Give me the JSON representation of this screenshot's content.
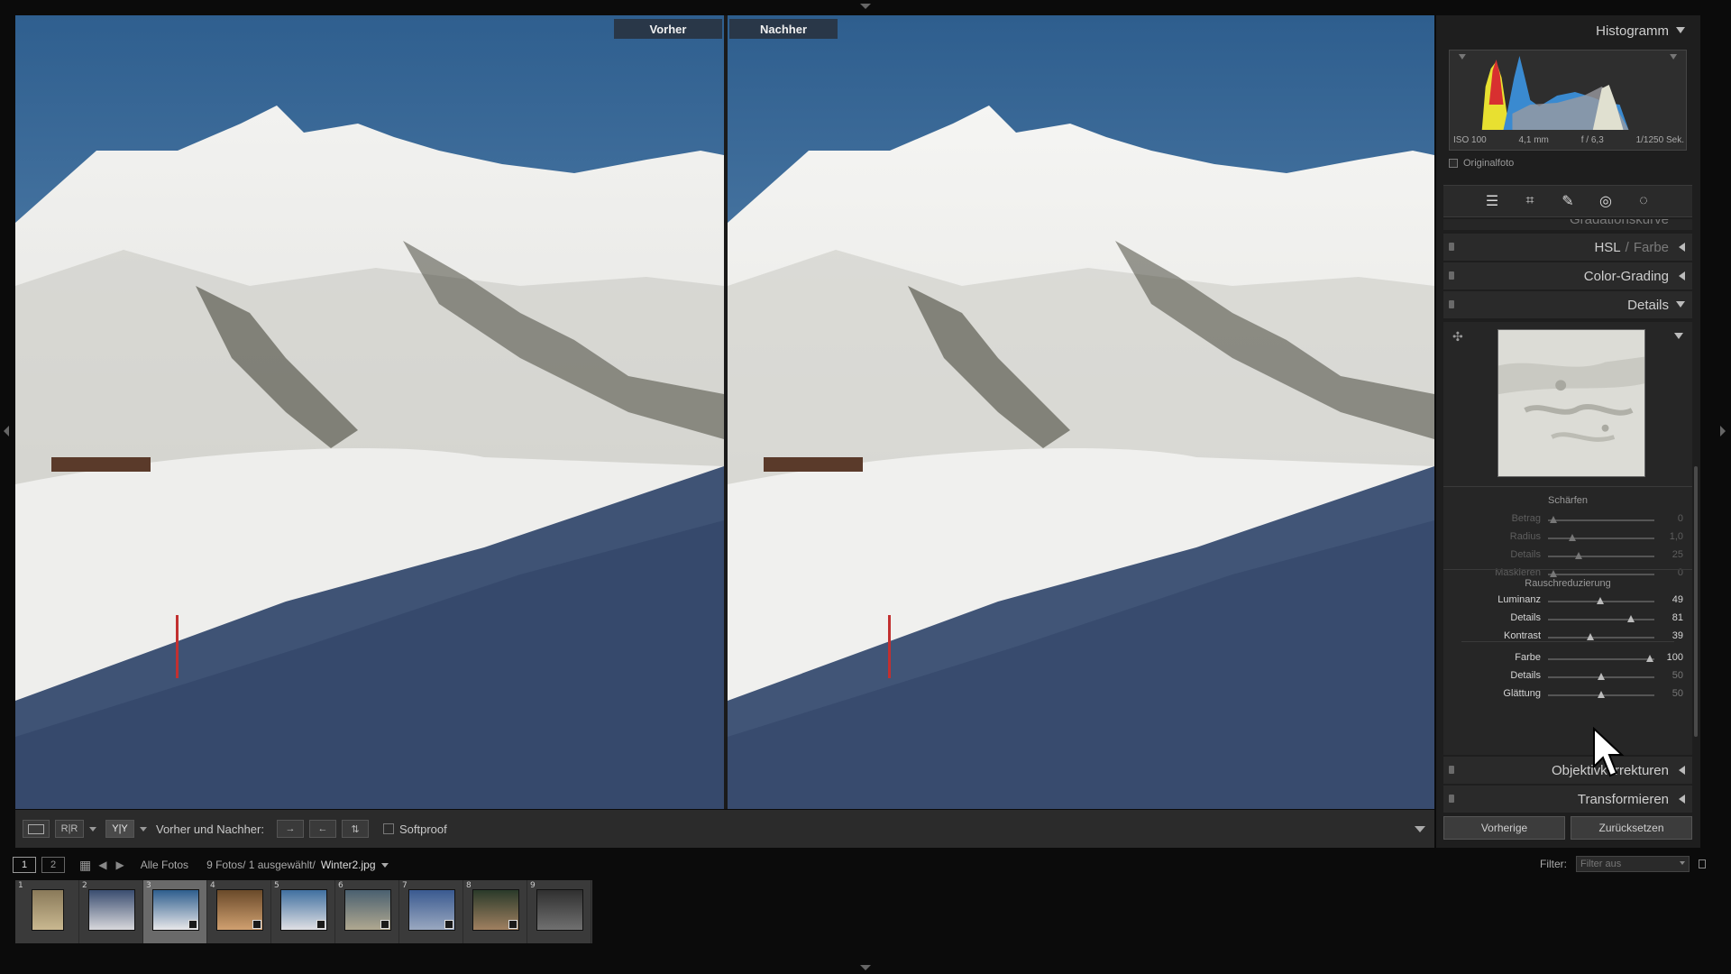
{
  "viewer": {
    "before_label": "Vorher",
    "after_label": "Nachher"
  },
  "toolbar": {
    "view_mode_label": "Vorher und Nachher:",
    "softproof_label": "Softproof",
    "btn_loupe": "",
    "btn_rr": "R|R",
    "btn_yy": "Y|Y"
  },
  "panels": {
    "histogram": "Histogramm",
    "histogram_info": {
      "iso": "ISO 100",
      "focal": "4,1 mm",
      "aperture": "f / 6,3",
      "shutter": "1/1250 Sek."
    },
    "original_photo": "Originalfoto",
    "gradation_curve": "Gradationskurve",
    "hsl": "HSL",
    "hsl_sep": "/",
    "color": "Farbe",
    "color_grading": "Color-Grading",
    "details": "Details",
    "lens_corrections": "Objektivkorrekturen",
    "transform": "Transformieren"
  },
  "details": {
    "sharpen_title": "Schärfen",
    "sharpen": [
      {
        "label": "Betrag",
        "value": "0",
        "pos": 0.05
      },
      {
        "label": "Radius",
        "value": "1,0",
        "pos": 0.23
      },
      {
        "label": "Details",
        "value": "25",
        "pos": 0.29
      },
      {
        "label": "Maskieren",
        "value": "0",
        "pos": 0.05
      }
    ],
    "noise_title": "Rauschreduzierung",
    "noise": [
      {
        "label": "Luminanz",
        "value": "49",
        "pos": 0.49
      },
      {
        "label": "Details",
        "value": "81",
        "pos": 0.78
      },
      {
        "label": "Kontrast",
        "value": "39",
        "pos": 0.4
      }
    ],
    "color_noise": [
      {
        "label": "Farbe",
        "value": "100",
        "pos": 0.96
      },
      {
        "label": "Details",
        "value": "50",
        "pos": 0.5
      },
      {
        "label": "Glättung",
        "value": "50",
        "pos": 0.5
      }
    ]
  },
  "buttons": {
    "previous": "Vorherige",
    "reset": "Zurücksetzen"
  },
  "filmstrip_bar": {
    "page1": "1",
    "page2": "2",
    "all_photos": "Alle Fotos",
    "count": "9 Fotos/ 1 ausgewählt/",
    "filename": "Winter2.jpg",
    "filter_label": "Filter:",
    "filter_value": "Filter aus"
  },
  "filmstrip": {
    "thumbs": [
      "1",
      "2",
      "3",
      "4",
      "5",
      "6",
      "7",
      "8",
      "9"
    ],
    "selected": 3
  },
  "colors": {
    "panel_bg": "#1e1e1e",
    "header_bg": "#2a2a2a",
    "accent_label": "#28303c"
  }
}
